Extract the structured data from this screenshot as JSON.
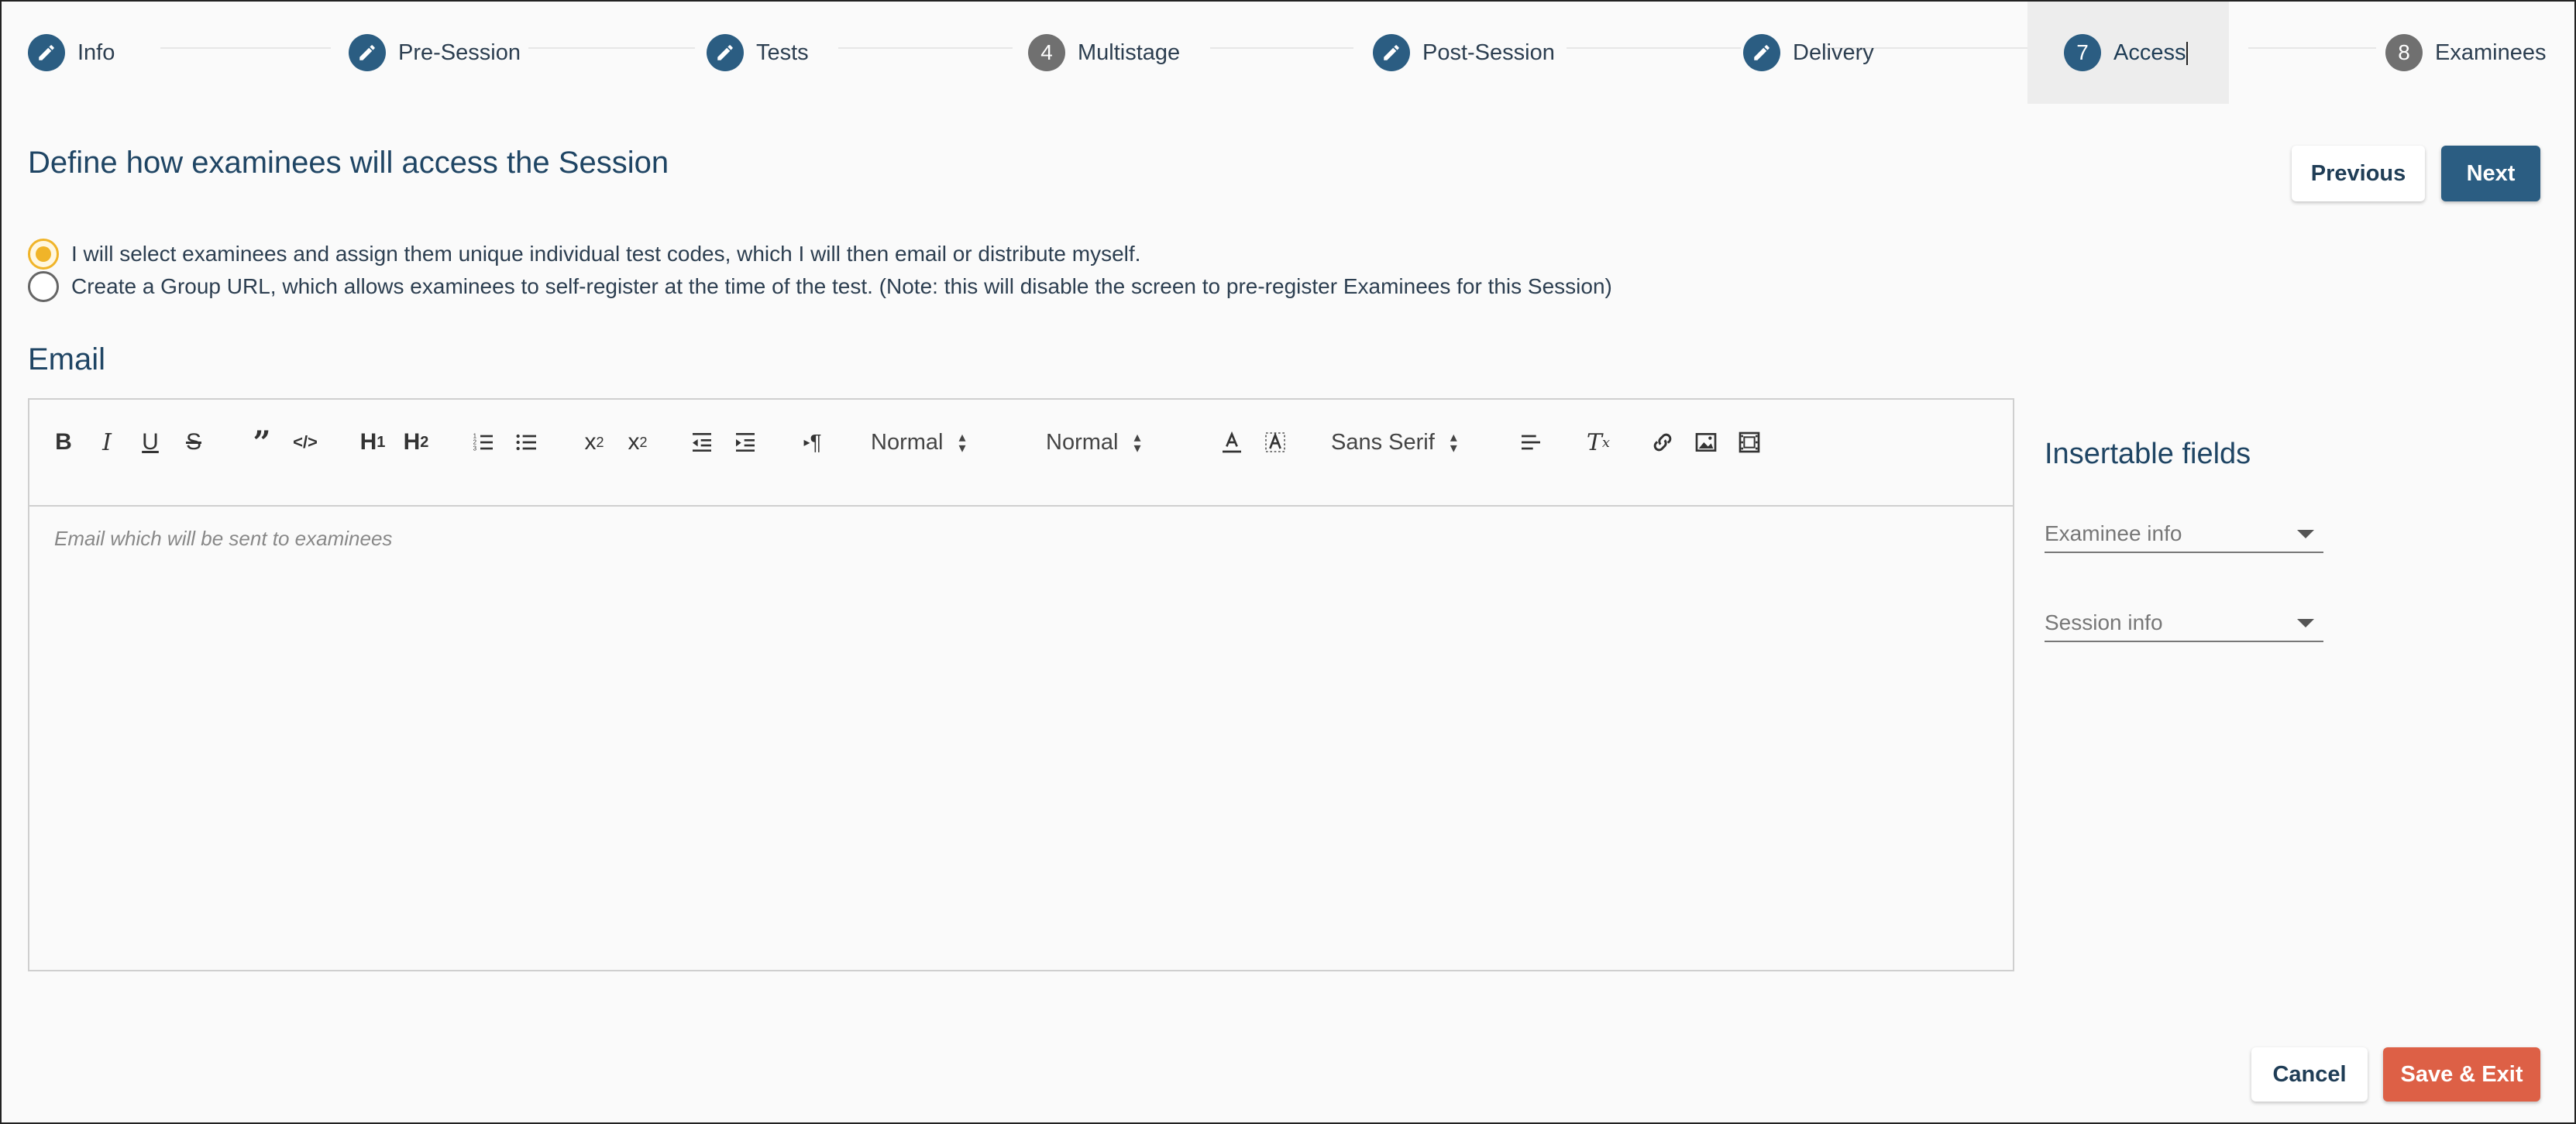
{
  "stepper": {
    "steps": [
      {
        "label": "Info",
        "icon": "pencil-icon",
        "badge": ""
      },
      {
        "label": "Pre-Session",
        "icon": "pencil-icon",
        "badge": ""
      },
      {
        "label": "Tests",
        "icon": "pencil-icon",
        "badge": ""
      },
      {
        "label": "Multistage",
        "icon": "number",
        "badge": "4"
      },
      {
        "label": "Post-Session",
        "icon": "pencil-icon",
        "badge": ""
      },
      {
        "label": "Delivery",
        "icon": "pencil-icon",
        "badge": ""
      },
      {
        "label": "Access",
        "icon": "number",
        "badge": "7",
        "active": true
      },
      {
        "label": "Examinees",
        "icon": "number",
        "badge": "8"
      }
    ]
  },
  "page": {
    "heading": "Define how examinees will access the Session",
    "previous_label": "Previous",
    "next_label": "Next"
  },
  "access_options": [
    {
      "label": "I will select examinees and assign them unique individual test codes, which I will then email or distribute myself.",
      "checked": true
    },
    {
      "label": "Create a Group URL, which allows examinees to self-register at the time of the test. (Note: this will disable the screen to pre-register Examinees for this Session)",
      "checked": false
    }
  ],
  "email": {
    "title": "Email",
    "placeholder": "Email which will be sent to examinees",
    "toolbar": {
      "header_select": "Normal",
      "size_select": "Normal",
      "font_select": "Sans Serif"
    }
  },
  "insertable": {
    "title": "Insertable fields",
    "examinee_placeholder": "Examinee info",
    "session_placeholder": "Session info"
  },
  "footer": {
    "cancel_label": "Cancel",
    "save_label": "Save & Exit"
  },
  "colors": {
    "primary": "#2b5d82",
    "accent_radio": "#f0b429",
    "danger": "#dd6046"
  }
}
